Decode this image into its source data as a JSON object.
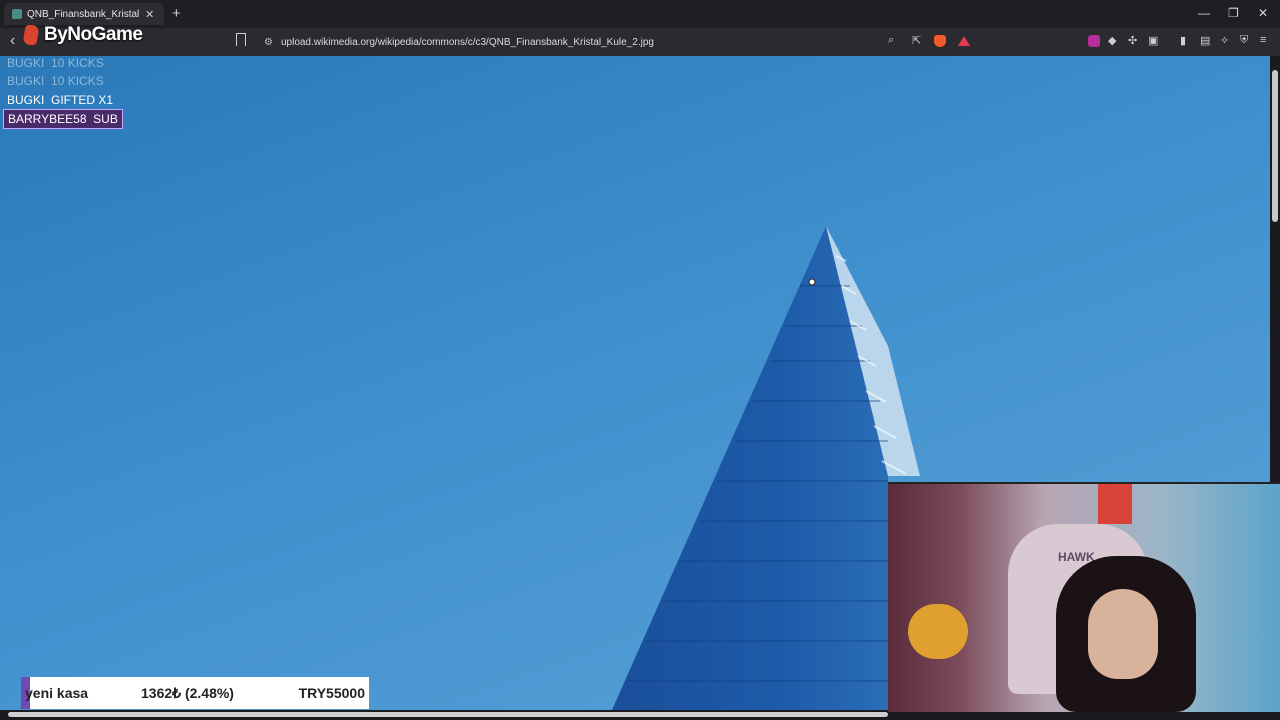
{
  "browser": {
    "tab_title": "QNB_Finansbank_Kristal_Kule_2...",
    "url": "upload.wikimedia.org/wikipedia/commons/c/c3/QNB_Finansbank_Kristal_Kule_2.jpg",
    "overlay_logo": "ByNoGame",
    "icons": [
      "back-icon",
      "bookmark-icon",
      "site-info-icon",
      "zoom-icon",
      "share-icon",
      "brave-shields-icon",
      "brave-rewards-icon",
      "extension-icon",
      "sidebar-icon",
      "wallet-icon",
      "leo-icon",
      "vpn-icon",
      "menu-icon"
    ]
  },
  "alerts": [
    {
      "user": "BUGKI",
      "action": "10 KICKS",
      "style": "faded"
    },
    {
      "user": "BUGKI",
      "action": "10 KICKS",
      "style": "faded"
    },
    {
      "user": "BUGKI",
      "action": "GIFTED X1",
      "style": "normal"
    },
    {
      "user": "BARRYBEE58",
      "action": "SUB",
      "style": "highlight"
    }
  ],
  "webcam": {
    "chair_text": "HAWK"
  },
  "goal": {
    "label": "yeni kasa",
    "amount": "1362₺ (2.48%)",
    "target": "TRY55000",
    "progress_fraction": 0.0248,
    "fill_color": "#6c4bb2"
  }
}
